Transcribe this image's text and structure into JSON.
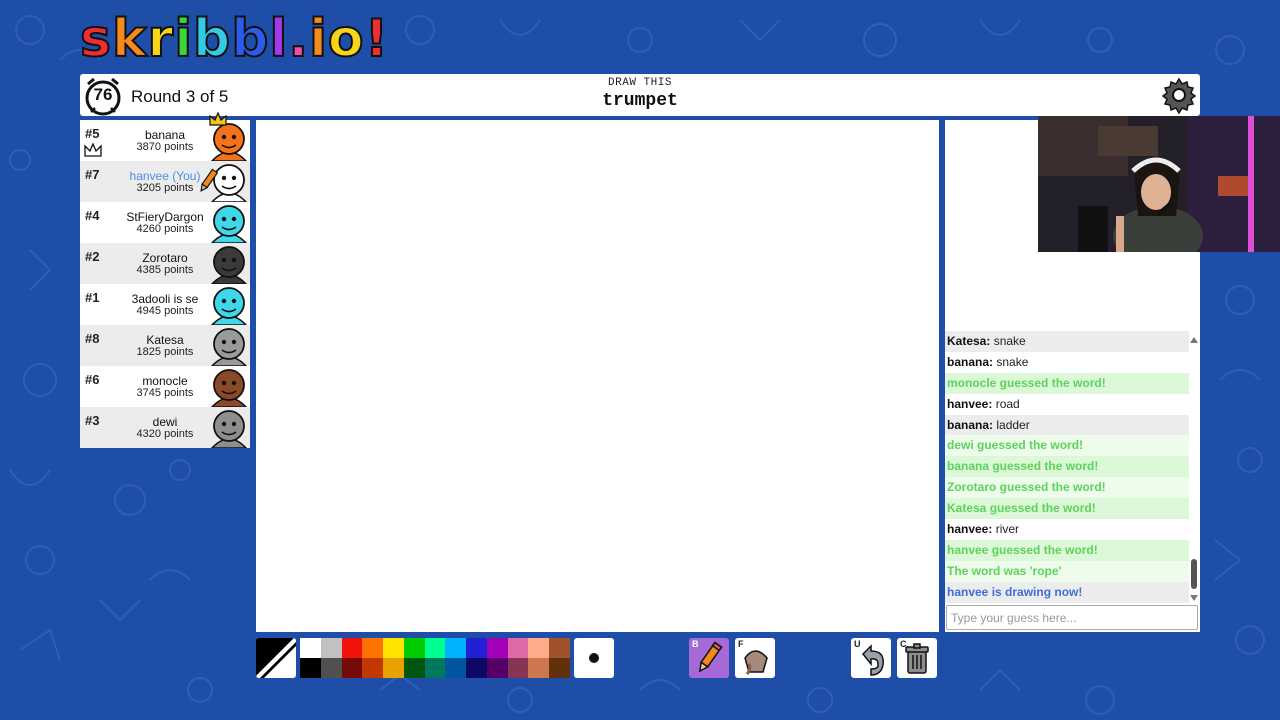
{
  "logo": {
    "letters": [
      "s",
      "k",
      "r",
      "i",
      "b",
      "b",
      "l",
      ".",
      "i",
      "o",
      "!"
    ],
    "colors": [
      "#ef2f2f",
      "#f78a1d",
      "#f9d51a",
      "#3bd63b",
      "#35c9e4",
      "#2b5be8",
      "#a338e8",
      "#ef4ca8",
      "#f78a1d",
      "#f9d51a",
      "#ef2f2f"
    ]
  },
  "header": {
    "timer": "76",
    "round": "Round 3 of 5",
    "hint_label": "DRAW THIS",
    "word": "trumpet"
  },
  "players": [
    {
      "rank": "#5",
      "name": "banana",
      "points": "3870 points",
      "avatar_color": "#f4721c",
      "you": false
    },
    {
      "rank": "#7",
      "name": "hanvee (You)",
      "points": "3205 points",
      "avatar_color": "#ffffff",
      "you": true
    },
    {
      "rank": "#4",
      "name": "StFieryDargon",
      "points": "4260 points",
      "avatar_color": "#3fd8e8",
      "you": false
    },
    {
      "rank": "#2",
      "name": "Zorotaro",
      "points": "4385 points",
      "avatar_color": "#3a3a3a",
      "you": false
    },
    {
      "rank": "#1",
      "name": "3adooli is se",
      "points": "4945 points",
      "avatar_color": "#3fd8e8",
      "you": false
    },
    {
      "rank": "#8",
      "name": "Katesa",
      "points": "1825 points",
      "avatar_color": "#9a9a9a",
      "you": false
    },
    {
      "rank": "#6",
      "name": "monocle",
      "points": "3745 points",
      "avatar_color": "#8a4a2a",
      "you": false
    },
    {
      "rank": "#3",
      "name": "dewi",
      "points": "4320 points",
      "avatar_color": "#8e8e8e",
      "you": false
    }
  ],
  "chat": [
    {
      "user": "Katesa:",
      "text": "snake",
      "style": "normal",
      "alt": true
    },
    {
      "user": "banana:",
      "text": "snake",
      "style": "normal",
      "alt": false
    },
    {
      "user": "",
      "text": "monocle guessed the word!",
      "style": "green",
      "alt": true
    },
    {
      "user": "hanvee:",
      "text": "road",
      "style": "normal",
      "alt": false
    },
    {
      "user": "banana:",
      "text": "ladder",
      "style": "normal",
      "alt": true
    },
    {
      "user": "",
      "text": "dewi guessed the word!",
      "style": "green",
      "alt": false
    },
    {
      "user": "",
      "text": "banana guessed the word!",
      "style": "green",
      "alt": true
    },
    {
      "user": "",
      "text": "Zorotaro guessed the word!",
      "style": "green",
      "alt": false
    },
    {
      "user": "",
      "text": "Katesa guessed the word!",
      "style": "green",
      "alt": true
    },
    {
      "user": "hanvee:",
      "text": "river",
      "style": "normal",
      "alt": false
    },
    {
      "user": "",
      "text": "hanvee guessed the word!",
      "style": "green",
      "alt": true
    },
    {
      "user": "",
      "text": "The word was 'rope'",
      "style": "green",
      "alt": false
    },
    {
      "user": "",
      "text": "hanvee is drawing now!",
      "style": "blue",
      "alt": true
    }
  ],
  "chat_input": {
    "placeholder": "Type your guess here..."
  },
  "palette": {
    "top": [
      "#ffffff",
      "#c1c1c1",
      "#ef130b",
      "#ff7100",
      "#ffe400",
      "#00cc00",
      "#00ff91",
      "#00b2ff",
      "#231fd3",
      "#a300ba",
      "#df69a7",
      "#ffac8e",
      "#a0522d"
    ],
    "bottom": [
      "#000000",
      "#505050",
      "#740b07",
      "#c23800",
      "#e8a200",
      "#005510",
      "#00785d",
      "#00569e",
      "#0e0865",
      "#550069",
      "#873554",
      "#cc774d",
      "#63300d"
    ]
  },
  "tools": {
    "pen_key": "B",
    "fill_key": "F",
    "undo_key": "U",
    "clear_key": "C"
  },
  "colors": {
    "background": "#1f4ea8",
    "you": "#4a8ee8",
    "guessed": "#5dd35b",
    "drawing_now": "#3d6fd8",
    "pen_selected": "#a66ad8"
  }
}
